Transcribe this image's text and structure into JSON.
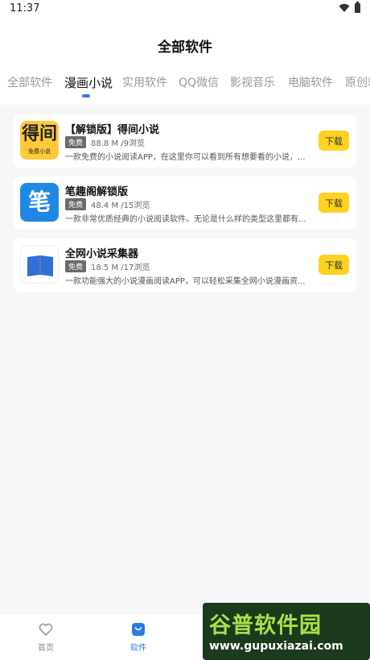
{
  "status_bar": {
    "time": "11:37"
  },
  "header": {
    "title": "全部软件"
  },
  "tabs": [
    {
      "label": "全部软件"
    },
    {
      "label": "漫画小说",
      "active": true
    },
    {
      "label": "实用软件"
    },
    {
      "label": "QQ微信"
    },
    {
      "label": "影视音乐"
    },
    {
      "label": "电脑软件"
    },
    {
      "label": "原创软件"
    }
  ],
  "apps": [
    {
      "name": "【解锁版】得间小说",
      "badge": "免费",
      "meta": "88.8 M /9浏览",
      "desc": "一款免费的小说阅读APP，在这里你可以看到所有想要看的小说，...",
      "button": "下载",
      "icon": {
        "name": "dejian-app-icon",
        "text_main": "得间",
        "text_sub": "免费小说",
        "bg": "#ffc93a"
      }
    },
    {
      "name": "笔趣阁解锁版",
      "badge": "免费",
      "meta": "48.4 M /15浏览",
      "desc": "一款非常优质经典的小说阅读软件。无论是什么样的类型这里都有...",
      "button": "下载",
      "icon": {
        "name": "biquge-app-icon",
        "text_main": "笔",
        "bg": "#1e88e5"
      }
    },
    {
      "name": "全网小说采集器",
      "badge": "免费",
      "meta": "18.5 M /17浏览",
      "desc": "一款功能强大的小说漫画阅读APP，可以轻松采集全网小说漫画资...",
      "button": "下载",
      "icon": {
        "name": "book-app-icon",
        "bg": "#ffffff"
      }
    }
  ],
  "bottom_nav": [
    {
      "label": "首页",
      "icon": "heart-icon"
    },
    {
      "label": "软件",
      "icon": "bag-icon",
      "active": true
    }
  ],
  "watermark": {
    "title": "谷普软件园",
    "url": "www.gupuxiazai.com"
  },
  "colors": {
    "accent": "#2a7de1",
    "button_bg": "#ffd21f",
    "badge_bg": "#6b6b6b"
  }
}
